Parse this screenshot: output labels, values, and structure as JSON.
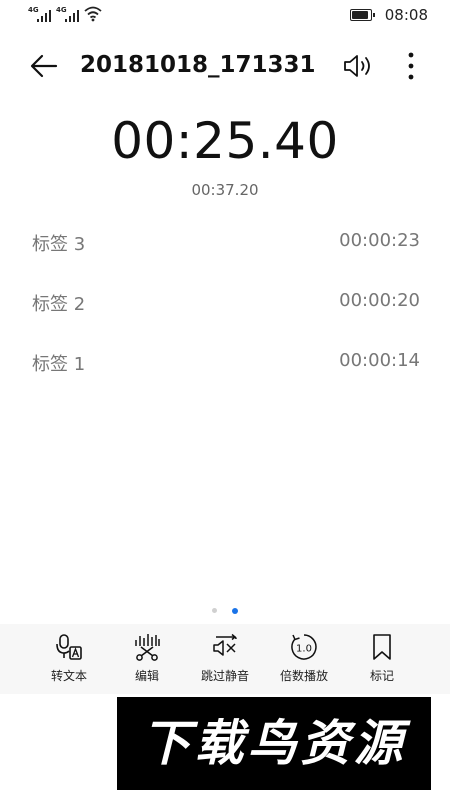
{
  "status_bar": {
    "signal_1_label": "4G",
    "signal_2_label": "4G",
    "time": "08:08",
    "icons": [
      "signal-icon",
      "signal-icon",
      "wifi-icon",
      "battery-icon"
    ]
  },
  "app_bar": {
    "title": "20181018_171331",
    "icons": [
      "back-arrow-icon",
      "speaker-icon",
      "more-vertical-icon"
    ]
  },
  "timer": {
    "elapsed": "00:25.40",
    "total": "00:37.20"
  },
  "markers": [
    {
      "label": "标签 3",
      "time": "00:00:23"
    },
    {
      "label": "标签 2",
      "time": "00:00:20"
    },
    {
      "label": "标签 1",
      "time": "00:00:14"
    }
  ],
  "pager": {
    "pages": 2,
    "active_index": 1
  },
  "toolbar": {
    "items": [
      {
        "label": "转文本",
        "icon": "speech-to-text-icon"
      },
      {
        "label": "编辑",
        "icon": "scissors-waveform-icon"
      },
      {
        "label": "跳过静音",
        "icon": "skip-silence-icon"
      },
      {
        "label": "倍数播放",
        "icon": "playback-speed-icon",
        "icon_text": "1.0"
      },
      {
        "label": "标记",
        "icon": "bookmark-icon"
      }
    ]
  },
  "watermark": {
    "text": "下载鸟资源"
  },
  "colors": {
    "accent": "#1a73e8",
    "text_primary": "#111111",
    "text_secondary": "#777777",
    "toolbar_background": "#f7f7f7"
  }
}
